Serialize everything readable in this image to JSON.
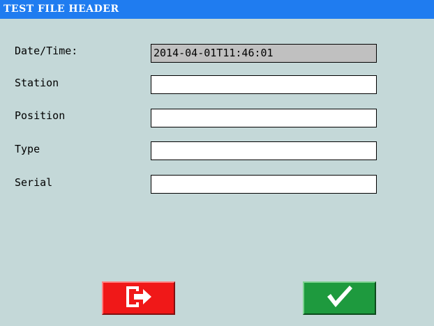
{
  "window": {
    "title": "TEST FILE HEADER"
  },
  "form": {
    "datetime": {
      "label": "Date/Time:",
      "value": "2014-04-01T11:46:01"
    },
    "station": {
      "label": "Station",
      "value": ""
    },
    "position": {
      "label": "Position",
      "value": ""
    },
    "type": {
      "label": "Type",
      "value": ""
    },
    "serial": {
      "label": "Serial",
      "value": ""
    }
  },
  "buttons": {
    "exit": {
      "icon": "exit-icon",
      "color": "#f01818"
    },
    "confirm": {
      "icon": "checkmark-icon",
      "color": "#1e9a3e"
    }
  },
  "colors": {
    "titlebar": "#1f7cf0",
    "background": "#c4d8d8",
    "readonly_field": "#c0c0c0"
  }
}
